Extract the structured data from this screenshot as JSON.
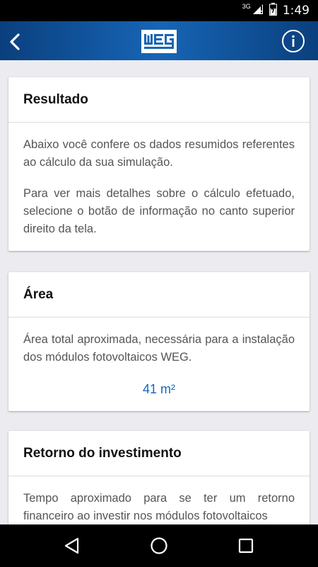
{
  "status_bar": {
    "time": "1:49",
    "network": "3G",
    "icons": [
      "signal-icon",
      "battery-icon"
    ]
  },
  "app_bar": {
    "logo_text": "WEG",
    "back_icon": "back-arrow-icon",
    "info_icon": "info-icon",
    "colors": {
      "gradient_dark": "#0a3f7d",
      "gradient_light": "#1765b6"
    }
  },
  "cards": {
    "resultado": {
      "title": "Resultado",
      "paragraph_1": "Abaixo você confere os dados resumidos referentes ao cálculo da sua simulação.",
      "paragraph_2": "Para ver mais detalhes sobre o cálculo efetuado, selecione o botão de informação no canto superior direito da tela."
    },
    "area": {
      "title": "Área",
      "description": "Área total aproximada, necessária para a instalação dos módulos fotovoltaicos WEG.",
      "value": "41 m²"
    },
    "retorno": {
      "title": "Retorno do investimento",
      "description": "Tempo aproximado para se ter um retorno financeiro ao investir nos módulos fotovoltaicos"
    }
  },
  "nav_bar": {
    "icons": [
      "back-triangle-icon",
      "home-circle-icon",
      "recents-square-icon"
    ]
  },
  "accent_color": "#1565c0"
}
